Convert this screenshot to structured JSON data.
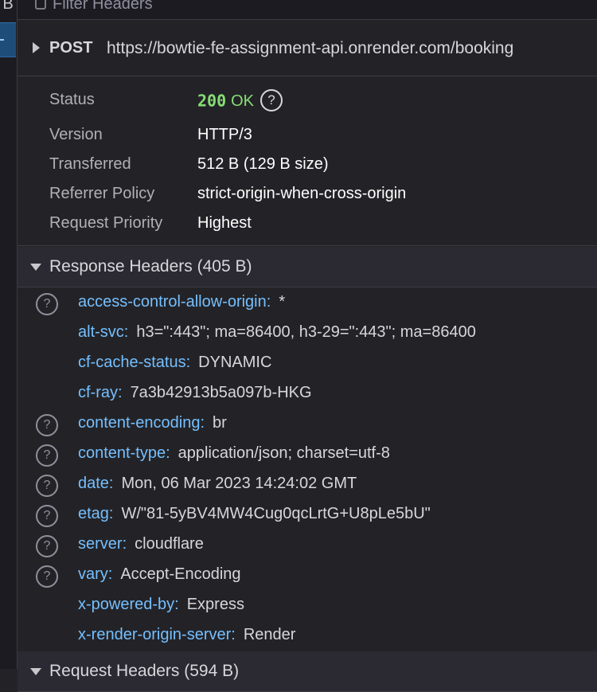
{
  "left_panel": {
    "label": "B"
  },
  "filter": {
    "placeholder": "Filter Headers"
  },
  "request": {
    "method": "POST",
    "url": "https://bowtie-fe-assignment-api.onrender.com/booking"
  },
  "summary": {
    "status": {
      "key": "Status",
      "code": "200",
      "text": "OK"
    },
    "version": {
      "key": "Version",
      "value": "HTTP/3"
    },
    "transferred": {
      "key": "Transferred",
      "value": "512 B (129 B size)"
    },
    "referrer_policy": {
      "key": "Referrer Policy",
      "value": "strict-origin-when-cross-origin"
    },
    "request_priority": {
      "key": "Request Priority",
      "value": "Highest"
    }
  },
  "response_headers": {
    "title": "Response Headers (405 B)",
    "items": [
      {
        "name": "access-control-allow-origin:",
        "value": "*",
        "help": true
      },
      {
        "name": "alt-svc:",
        "value": "h3=\":443\"; ma=86400, h3-29=\":443\"; ma=86400",
        "help": false
      },
      {
        "name": "cf-cache-status:",
        "value": "DYNAMIC",
        "help": false
      },
      {
        "name": "cf-ray:",
        "value": "7a3b42913b5a097b-HKG",
        "help": false
      },
      {
        "name": "content-encoding:",
        "value": "br",
        "help": true
      },
      {
        "name": "content-type:",
        "value": "application/json; charset=utf-8",
        "help": true
      },
      {
        "name": "date:",
        "value": "Mon, 06 Mar 2023 14:24:02 GMT",
        "help": true
      },
      {
        "name": "etag:",
        "value": "W/\"81-5yBV4MW4Cug0qcLrtG+U8pLe5bU\"",
        "help": true
      },
      {
        "name": "server:",
        "value": "cloudflare",
        "help": true
      },
      {
        "name": "vary:",
        "value": "Accept-Encoding",
        "help": true
      },
      {
        "name": "x-powered-by:",
        "value": "Express",
        "help": false
      },
      {
        "name": "x-render-origin-server:",
        "value": "Render",
        "help": false
      }
    ]
  },
  "request_headers": {
    "title": "Request Headers (594 B)"
  },
  "help_glyph": "?"
}
